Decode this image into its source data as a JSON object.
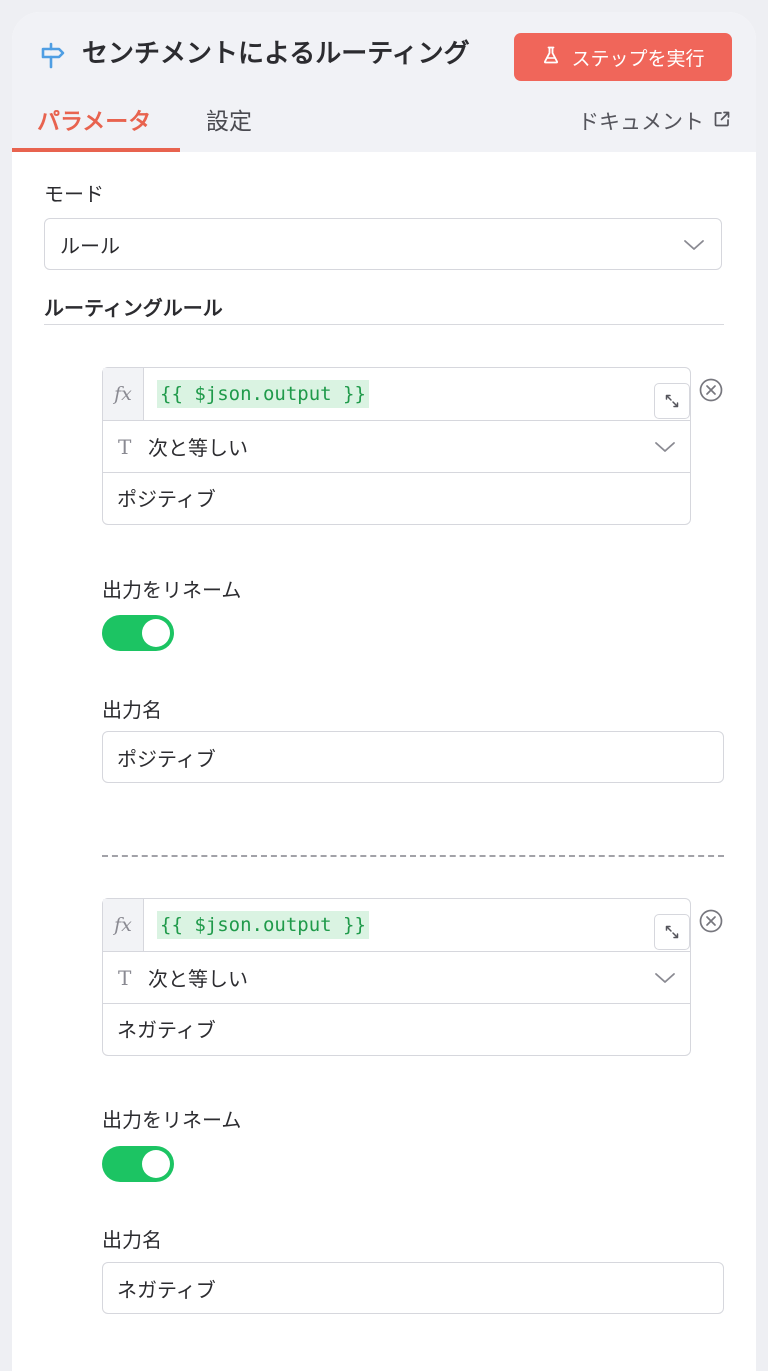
{
  "header": {
    "title": "センチメントによるルーティング",
    "run_button_label": "ステップを実行",
    "tabs": [
      {
        "label": "パラメータ",
        "active": true
      },
      {
        "label": "設定",
        "active": false
      }
    ],
    "docs_label": "ドキュメント",
    "accent_color": "#e8634f",
    "run_button_color": "#f0665a",
    "node_icon": "signpost-icon"
  },
  "params": {
    "mode_label": "モード",
    "mode_value": "ルール",
    "rules_heading": "ルーティングルール",
    "rules": [
      {
        "fx_label": "fx",
        "expression": "{{ $json.output }}",
        "operator_type_icon": "T",
        "operator": "次と等しい",
        "value": "ポジティブ",
        "rename_label": "出力をリネーム",
        "rename_enabled": true,
        "output_name_label": "出力名",
        "output_name": "ポジティブ"
      },
      {
        "fx_label": "fx",
        "expression": "{{ $json.output }}",
        "operator_type_icon": "T",
        "operator": "次と等しい",
        "value": "ネガティブ",
        "rename_label": "出力をリネーム",
        "rename_enabled": true,
        "output_name_label": "出力名",
        "output_name": "ネガティブ"
      }
    ],
    "toggle_color": "#1cc463"
  }
}
